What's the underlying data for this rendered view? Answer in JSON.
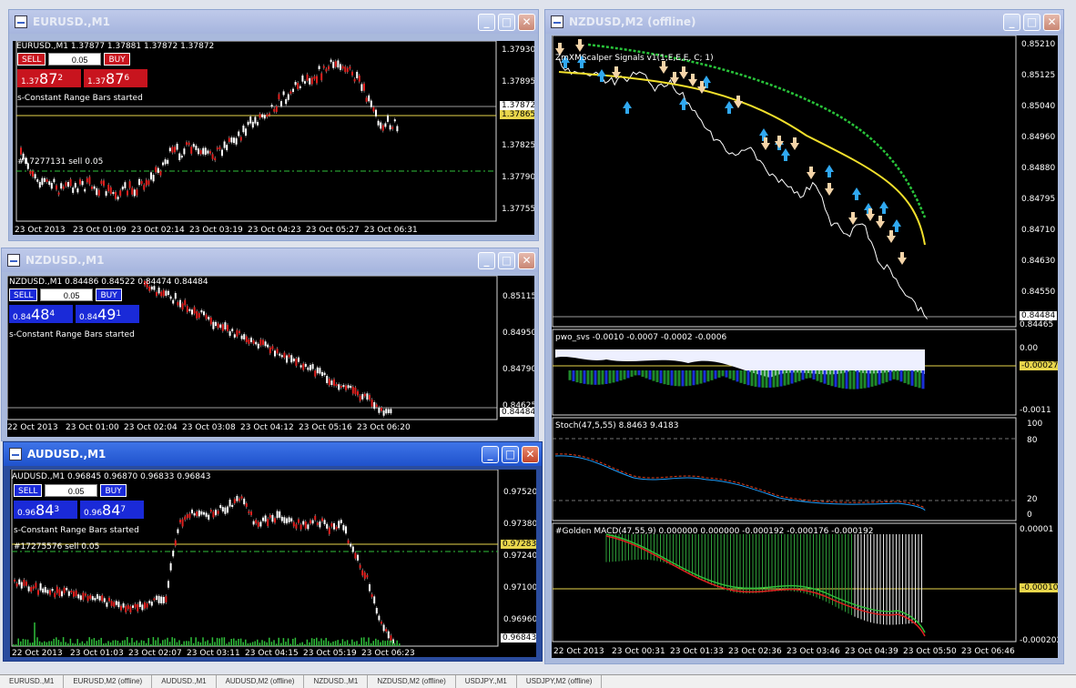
{
  "windows": {
    "eurusd": {
      "title": "EURUSD.,M1",
      "info": "EURUSD.,M1  1.37877 1.37881 1.37872 1.37872",
      "sell": "SELL",
      "buy": "BUY",
      "lot": "0.05",
      "bid_pre": "1.37",
      "bid_big": "87",
      "bid_sup": "2",
      "ask_pre": "1.37",
      "ask_big": "87",
      "ask_sup": "6",
      "status": "s-Constant Range Bars started",
      "order": "#17277131 sell 0.05",
      "price_tag": "1.37872",
      "price_tag2": "1.37865",
      "prices": [
        "1.37930",
        "1.37895",
        "1.37860",
        "1.37825",
        "1.37790",
        "1.37755"
      ],
      "times": [
        "23 Oct 2013",
        "23 Oct 01:09",
        "23 Oct 02:14",
        "23 Oct 03:19",
        "23 Oct 04:23",
        "23 Oct 05:27",
        "23 Oct 06:31"
      ]
    },
    "nzdusd_m1": {
      "title": "NZDUSD.,M1",
      "info": "NZDUSD.,M1  0.84486 0.84522 0.84474 0.84484",
      "sell": "SELL",
      "buy": "BUY",
      "lot": "0.05",
      "bid_pre": "0.84",
      "bid_big": "48",
      "bid_sup": "4",
      "ask_pre": "0.84",
      "ask_big": "49",
      "ask_sup": "1",
      "status": "s-Constant Range Bars started",
      "price_tag": "0.84484",
      "prices": [
        "0.85115",
        "0.84950",
        "0.84790",
        "0.84625"
      ],
      "times": [
        "22 Oct 2013",
        "23 Oct 01:00",
        "23 Oct 02:04",
        "23 Oct 03:08",
        "23 Oct 04:12",
        "23 Oct 05:16",
        "23 Oct 06:20"
      ]
    },
    "audusd": {
      "title": "AUDUSD.,M1",
      "info": "AUDUSD.,M1  0.96845 0.96870 0.96833 0.96843",
      "sell": "SELL",
      "buy": "BUY",
      "lot": "0.05",
      "bid_pre": "0.96",
      "bid_big": "84",
      "bid_sup": "3",
      "ask_pre": "0.96",
      "ask_big": "84",
      "ask_sup": "7",
      "status": "s-Constant Range Bars started",
      "order": "#17275576 sell 0.05",
      "price_tag": "0.97283",
      "price_tag2": "0.96843",
      "prices": [
        "0.97520",
        "0.97380",
        "0.97240",
        "0.97100",
        "0.96960"
      ],
      "times": [
        "22 Oct 2013",
        "23 Oct 01:03",
        "23 Oct 02:07",
        "23 Oct 03:11",
        "23 Oct 04:15",
        "23 Oct 05:19",
        "23 Oct 06:23"
      ]
    },
    "nzdusd_m2": {
      "title": "NZDUSD,M2 (offline)",
      "indicator": "ZmXMScalper Signals v1(1,E,E,E, C; 1)",
      "price_tag": "0.84484",
      "price_tag_low": "0.84465",
      "prices": [
        "0.85210",
        "0.85125",
        "0.85040",
        "0.84960",
        "0.84880",
        "0.84795",
        "0.84710",
        "0.84630",
        "0.84550"
      ],
      "pwo_label": "pwo_svs -0.0010 -0.0007 -0.0002 -0.0006",
      "pwo_scale": [
        "0.00",
        "-0.0011"
      ],
      "pwo_tag": "-0.00027",
      "stoch_label": "Stoch(47,5,55) 8.8463 9.4183",
      "stoch_scale": [
        "100",
        "80",
        "20",
        "0"
      ],
      "macd_label": "#Golden MACD(47,55,9) 0.000000 0.000000 -0.000192 -0.000176 -0.000192",
      "macd_scale": [
        "0.00001",
        "-0.000202"
      ],
      "macd_tag": "-0.00010",
      "times": [
        "22 Oct 2013",
        "23 Oct 00:31",
        "23 Oct 01:33",
        "23 Oct 02:36",
        "23 Oct 03:46",
        "23 Oct 04:39",
        "23 Oct 05:50",
        "23 Oct 06:46"
      ]
    }
  },
  "taskbar": [
    "EURUSD.,M1",
    "EURUSD,M2 (offline)",
    "AUDUSD.,M1",
    "AUDUSD,M2 (offline)",
    "NZDUSD.,M1",
    "NZDUSD,M2 (offline)",
    "USDJPY.,M1",
    "USDJPY,M2 (offline)"
  ],
  "colors": {
    "sell_red": "#c8141e",
    "buy_blue": "#1a2ad8",
    "bull_candle": "#ffffff",
    "bear_candle": "#e0201e",
    "level_yellow": "#e8d64c",
    "order_green": "#2fbf3a",
    "arrow_blue": "#30a8f0",
    "arrow_peach": "#f4d4a8"
  }
}
